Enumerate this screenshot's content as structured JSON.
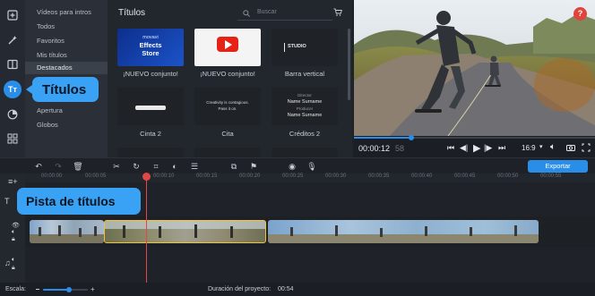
{
  "sidebar": {
    "items": [
      {
        "label": "Vídeos para intros",
        "selected": false
      },
      {
        "label": "Todos",
        "selected": false
      },
      {
        "label": "Favoritos",
        "selected": false
      },
      {
        "label": "Mis títulos",
        "selected": false
      },
      {
        "label": "Destacados",
        "selected": true
      },
      {
        "label": "Apertura",
        "selected": false
      },
      {
        "label": "Globos",
        "selected": false
      }
    ]
  },
  "callouts": {
    "titles": "Títulos",
    "track": "Pista de títulos"
  },
  "panel": {
    "title": "Títulos",
    "search_placeholder": "Buscar",
    "thumbnails": [
      {
        "caption": "¡NUEVO conjunto!",
        "lines": [
          "movavi",
          "Effects",
          "Store"
        ]
      },
      {
        "caption": "¡NUEVO conjunto!",
        "lines": []
      },
      {
        "caption": "Barra vertical",
        "lines": [
          "STUDIO"
        ]
      },
      {
        "caption": "Cinta 2",
        "lines": []
      },
      {
        "caption": "Cita",
        "lines": [
          "Creativity is contagious.",
          "Pass it on."
        ]
      },
      {
        "caption": "Créditos 2",
        "lines": [
          "Director",
          "Name Surname",
          "Producer",
          "Name Surname"
        ]
      }
    ]
  },
  "player": {
    "time_current": "00:00:12",
    "time_total": "58",
    "aspect": "16:9"
  },
  "toolbar": {
    "export_label": "Exportar"
  },
  "ruler": {
    "ticks": [
      "00:00:00",
      "00:00:05",
      "00:00:10",
      "00:00:15",
      "00:00:20",
      "00:00:25",
      "00:00:30",
      "00:00:35",
      "00:00:40",
      "00:00:45",
      "00:00:50",
      "00:00:55"
    ]
  },
  "status": {
    "zoom_label": "Escala:",
    "duration_label": "Duración del proyecto:",
    "duration_value": "00:54"
  },
  "colors": {
    "accent": "#2a8ee8",
    "callout": "#3aa2f5",
    "playhead": "#e04848",
    "clip_selected": "#f2c13a"
  },
  "icons": [
    "folder-add-icon",
    "magic-wand-icon",
    "transition-icon",
    "titles-icon",
    "sticker-icon",
    "more-tools-icon",
    "cart-icon",
    "help-icon"
  ]
}
